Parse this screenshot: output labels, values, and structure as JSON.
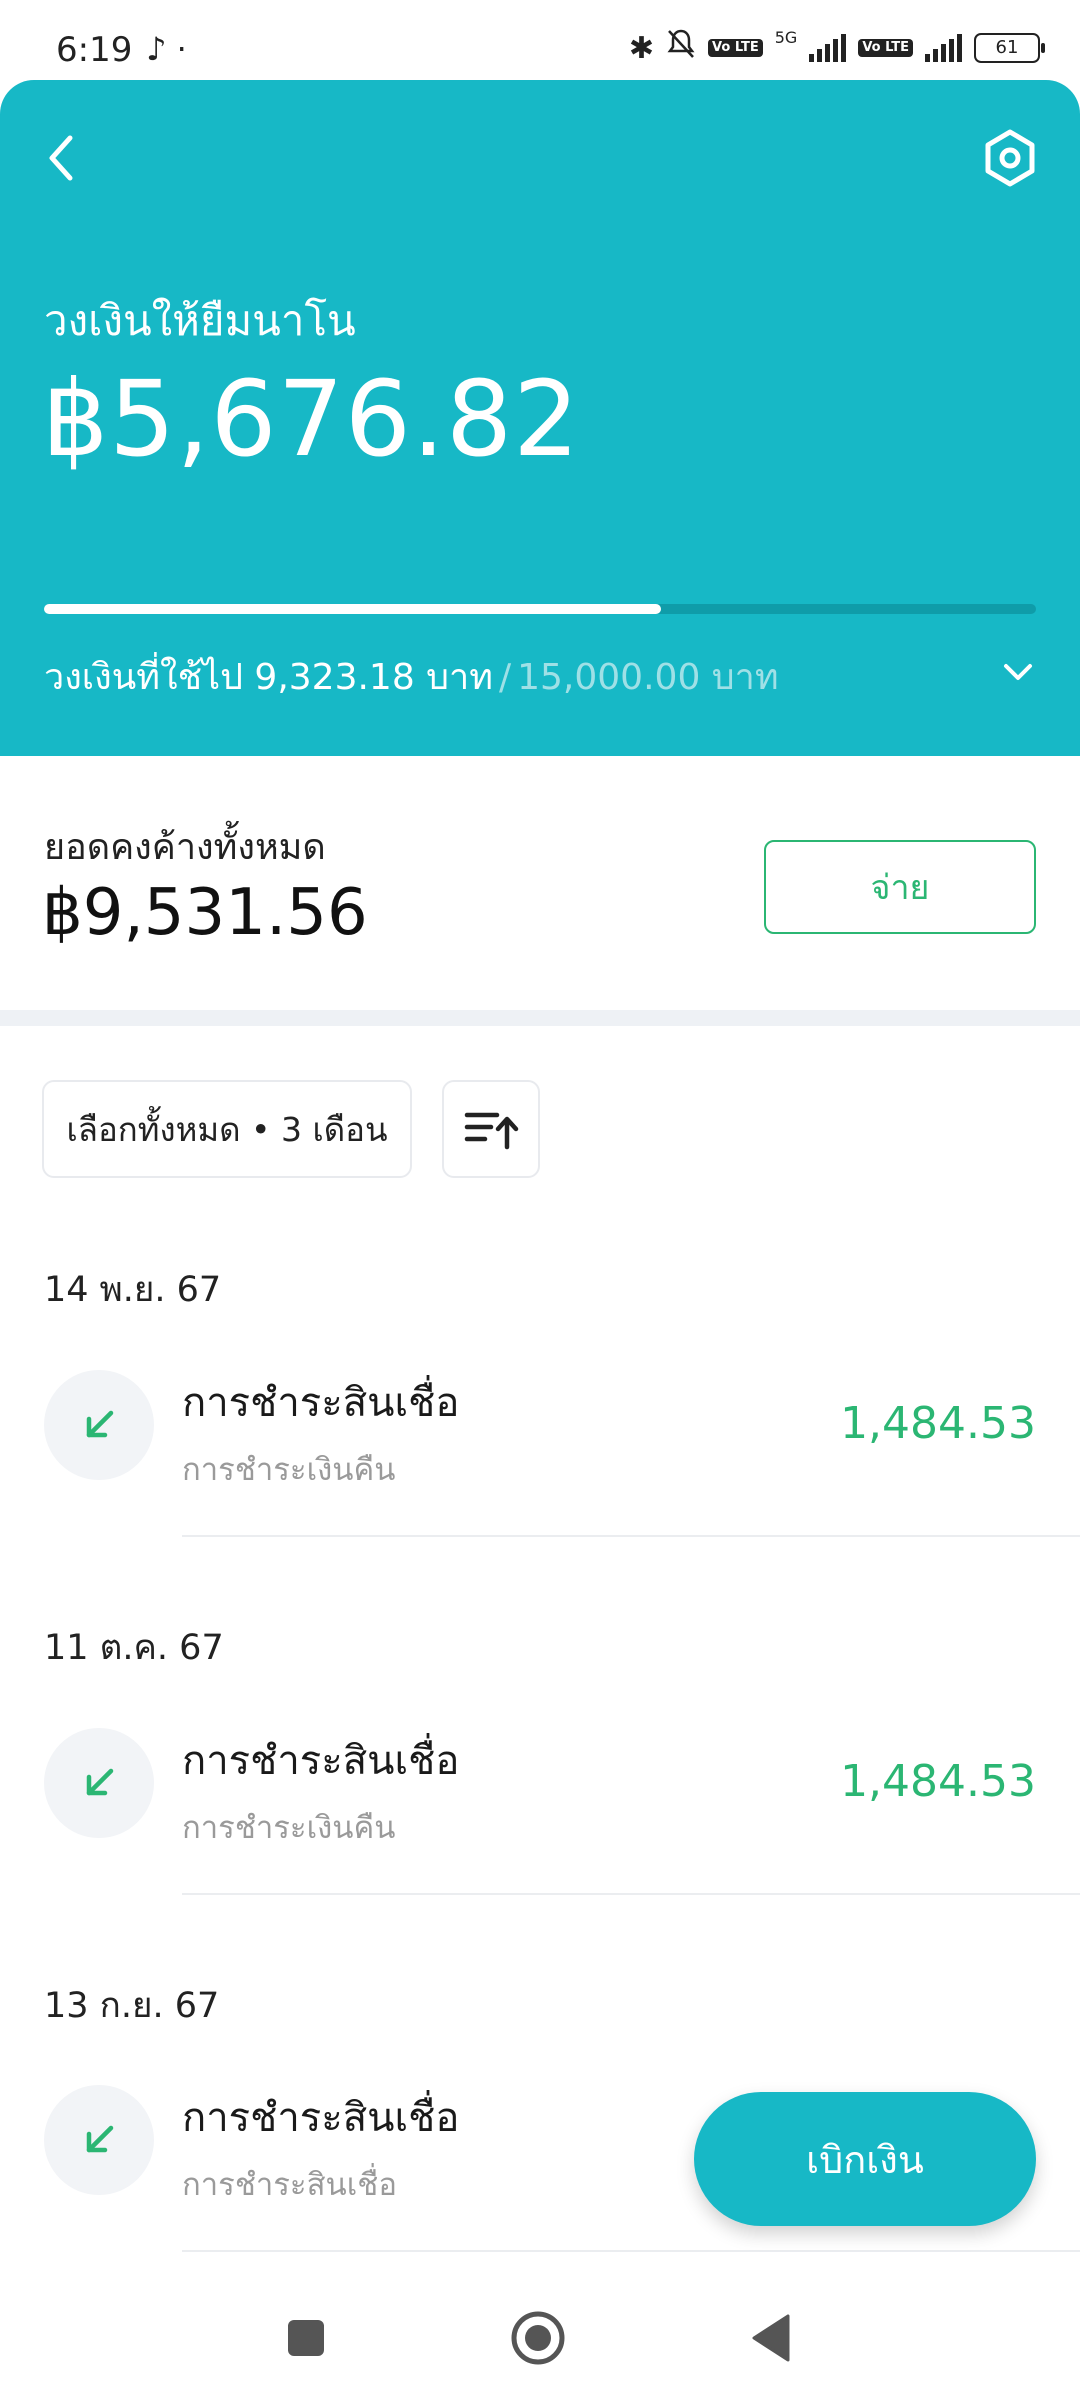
{
  "status_bar": {
    "time": "6:19",
    "left_icons": [
      "tiktok-icon",
      "dot-icon"
    ],
    "volte_label": "Vo LTE",
    "network_label": "5G",
    "battery": "61"
  },
  "header": {
    "credit_title": "วงเงินให้ยืมนาโน",
    "credit_amount": "฿5,676.82",
    "used_fraction": 0.6216,
    "used_text": "วงเงินที่ใช้ไป 9,323.18 บาท",
    "separator": "/",
    "total_text": "15,000.00 บาท",
    "colors": {
      "background": "#17b8c6",
      "track": "#0f9ca9",
      "fill": "#ffffff"
    }
  },
  "balance": {
    "label": "ยอดคงค้างทั้งหมด",
    "value": "฿9,531.56",
    "pay_label": "จ่าย"
  },
  "filter": {
    "chip_label": "เลือกทั้งหมด • 3 เดือน",
    "sort_icon": "sort-ascending-icon"
  },
  "transactions": [
    {
      "date": "14 พ.ย. 67",
      "title": "การชำระสินเชื่อ",
      "subtitle": "การชำระเงินคืน",
      "amount": "1,484.53"
    },
    {
      "date": "11 ต.ค. 67",
      "title": "การชำระสินเชื่อ",
      "subtitle": "การชำระเงินคืน",
      "amount": "1,484.53"
    },
    {
      "date": "13 ก.ย. 67",
      "title": "การชำระสินเชื่อ",
      "subtitle": "การชำระสินเชื่อ",
      "amount": ""
    }
  ],
  "withdraw_label": "เบิกเงิน",
  "colors": {
    "accent": "#17b8c6",
    "positive": "#2bb673"
  }
}
